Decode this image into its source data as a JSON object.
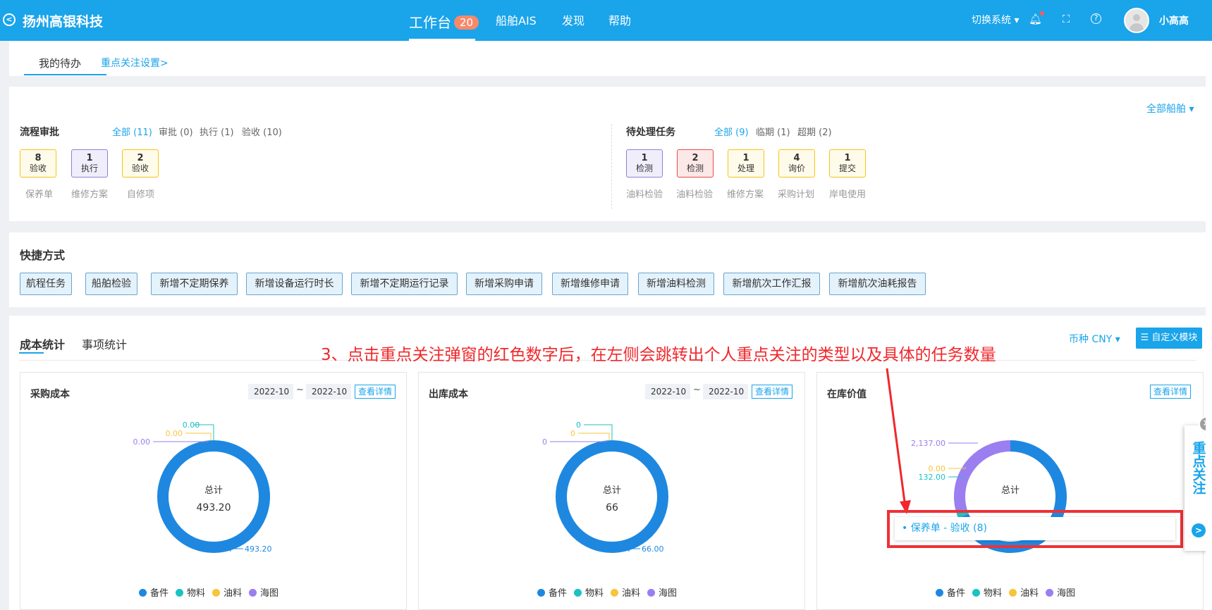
{
  "header": {
    "brand": "扬州高银科技",
    "nav": [
      {
        "label": "工作台",
        "badge": "20"
      },
      {
        "label": "船舶AIS"
      },
      {
        "label": "发现"
      },
      {
        "label": "帮助"
      }
    ],
    "switch_system": "切换系统",
    "user_name": "小高高"
  },
  "tabs": {
    "my_todo": "我的待办",
    "focus_settings": "重点关注设置>"
  },
  "all_ships": "全部船舶",
  "approval": {
    "title": "流程审批",
    "filters": [
      "全部 (11)",
      "审批 (0)",
      "执行 (1)",
      "验收 (10)"
    ],
    "boxes": [
      {
        "num": "8",
        "label": "验收",
        "caption": "保养单"
      },
      {
        "num": "1",
        "label": "执行",
        "caption": "维修方案"
      },
      {
        "num": "2",
        "label": "验收",
        "caption": "自修项"
      }
    ]
  },
  "pending": {
    "title": "待处理任务",
    "filters": [
      "全部 (9)",
      "临期 (1)",
      "超期 (2)"
    ],
    "boxes": [
      {
        "num": "1",
        "label": "检测",
        "caption": "油料检验"
      },
      {
        "num": "2",
        "label": "检测",
        "caption": "油料检验"
      },
      {
        "num": "1",
        "label": "处理",
        "caption": "维修方案"
      },
      {
        "num": "4",
        "label": "询价",
        "caption": "采购计划"
      },
      {
        "num": "1",
        "label": "提交",
        "caption": "岸电使用"
      }
    ]
  },
  "shortcuts": {
    "title": "快捷方式",
    "items": [
      "航程任务",
      "船舶检验",
      "新增不定期保养",
      "新增设备运行时长",
      "新增不定期运行记录",
      "新增采购申请",
      "新增维修申请",
      "新增油料检测",
      "新增航次工作汇报",
      "新增航次油耗报告"
    ]
  },
  "stats": {
    "tabs": [
      "成本统计",
      "事项统计"
    ],
    "currency": "币种  CNY",
    "custom_button": "自定义模块",
    "annotation": "3、点击重点关注弹窗的红色数字后，在左侧会跳转出个人重点关注的类型以及具体的任务数量",
    "detail_label": "查看详情",
    "legend": [
      "备件",
      "物料",
      "油料",
      "海图"
    ],
    "legend_colors": [
      "#1e88e0",
      "#1bc2c2",
      "#f7c53b",
      "#9b7ef0"
    ]
  },
  "chart_data": [
    {
      "type": "pie",
      "title": "采购成本",
      "date_from": "2022-10",
      "date_to": "2022-10",
      "center_label": "总计",
      "total": "493.20",
      "categories": [
        "备件",
        "物料",
        "油料",
        "海图"
      ],
      "values": [
        493.2,
        0,
        0,
        0
      ],
      "labels": [
        "493.20",
        "0.00",
        "0.00",
        "0.00"
      ]
    },
    {
      "type": "pie",
      "title": "出库成本",
      "date_from": "2022-10",
      "date_to": "2022-10",
      "center_label": "总计",
      "total": "66",
      "categories": [
        "备件",
        "物料",
        "油料",
        "海图"
      ],
      "values": [
        66,
        0,
        0,
        0
      ],
      "labels": [
        "66.00",
        "0",
        "0",
        "0"
      ]
    },
    {
      "type": "pie",
      "title": "在库价值",
      "center_label": "总计",
      "categories": [
        "备件",
        "物料",
        "油料",
        "海图"
      ],
      "values": [
        5000,
        132,
        0,
        2137
      ],
      "labels": [
        "",
        "132.00",
        "0.00",
        "2,137.00"
      ]
    }
  ],
  "focus_popup": {
    "side_title": "重点关注",
    "item": "• 保养单  -   验收  (8)"
  }
}
